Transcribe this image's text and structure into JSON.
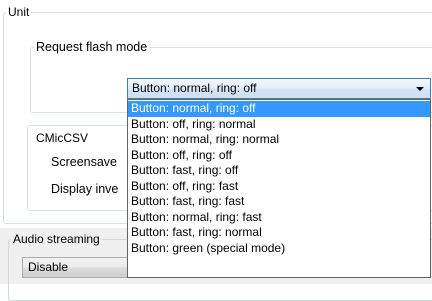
{
  "unit_group": {
    "title": "Unit",
    "request_flash": {
      "title": "Request flash mode",
      "selected": "Button: normal, ring: off",
      "options": [
        "Button: normal, ring: off",
        "Button: off, ring: normal",
        "Button: normal, ring: normal",
        "Button: off, ring: off",
        "Button: fast, ring: off",
        "Button: off, ring: fast",
        "Button: fast, ring: fast",
        "Button: normal, ring: fast",
        "Button: fast, ring: normal",
        "Button: green (special mode)"
      ],
      "highlighted_index": 0
    },
    "cmiccsv": {
      "title": "CMicCSV",
      "screensaver_label": "Screensave",
      "display_label": "Display inve"
    }
  },
  "audio_streaming": {
    "title": "Audio streaming",
    "value": "Disable"
  },
  "colors": {
    "highlight": "#3399ff",
    "combo_border": "#3c7fb1",
    "groupbox_border": "#d5dfe5"
  }
}
